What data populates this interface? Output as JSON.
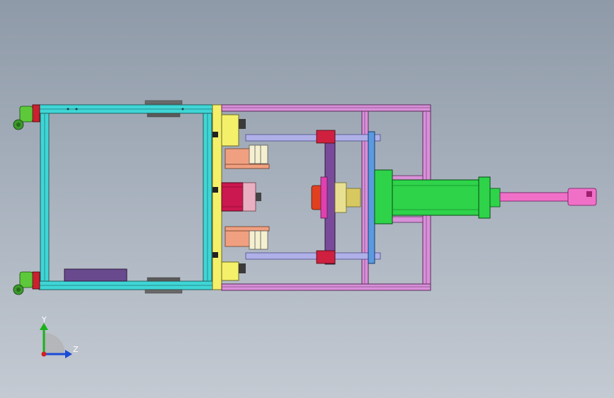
{
  "viewport": {
    "background_top": "#8f9aa8",
    "background_bottom": "#c4cad2"
  },
  "colors": {
    "frame_cyan": "#3fd6d6",
    "frame_magenta": "#d890d8",
    "plate_yellow": "#f5f06a",
    "cylinder_green": "#2ed34a",
    "rod_pink": "#f070c8",
    "motor_red": "#cc1850",
    "bracket_salmon": "#f0a080",
    "plate_purple": "#7a4a9a",
    "caster_green": "#5cc83a",
    "blue_guide": "#5a9ae0"
  },
  "triad": {
    "y_label": "Y",
    "z_label": "Z",
    "y_icon": "axis-y-arrow-icon",
    "z_icon": "axis-z-arrow-icon"
  }
}
